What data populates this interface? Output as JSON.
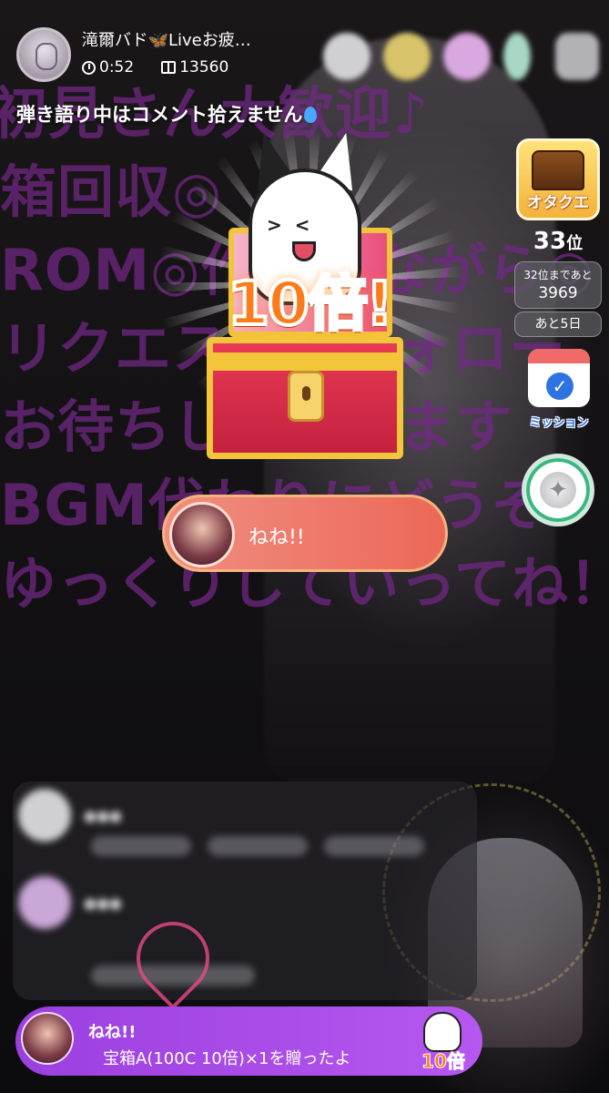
{
  "host": {
    "name": "滝爾バド🦋Liveお疲…",
    "elapsed": "0:52",
    "gift_points": "13560"
  },
  "stream_title": "弾き語り中はコメント拾えません",
  "overlay_lines": [
    "初見さん大歓迎♪",
    "箱回収◎",
    "ROM◎作業しながら◎",
    "リクエスト◎フォロー",
    "お待ちしております",
    "BGM代わりにどうぞ！",
    "ゆっくりしていってね！"
  ],
  "event_panel": {
    "badge_label": "オタクエ",
    "rank_number": "33",
    "rank_suffix": "位",
    "next_rank_label": "32位まであと",
    "next_rank_value": "3969",
    "days_left": "あと5日"
  },
  "mission": {
    "label": "ミッション"
  },
  "gift_effect": {
    "multiplier_label": "10倍!",
    "sender_name": "ねね!!"
  },
  "gift_banner": {
    "sender": "ねね!!",
    "message": "宝箱A(100C 10倍)×1を贈ったよ",
    "badge_label": "10倍"
  },
  "colors": {
    "overlay_text": "#73288a",
    "banner": "#a64ae6",
    "pill": "#ee7a6a",
    "mission_blue": "#2e74e0"
  }
}
